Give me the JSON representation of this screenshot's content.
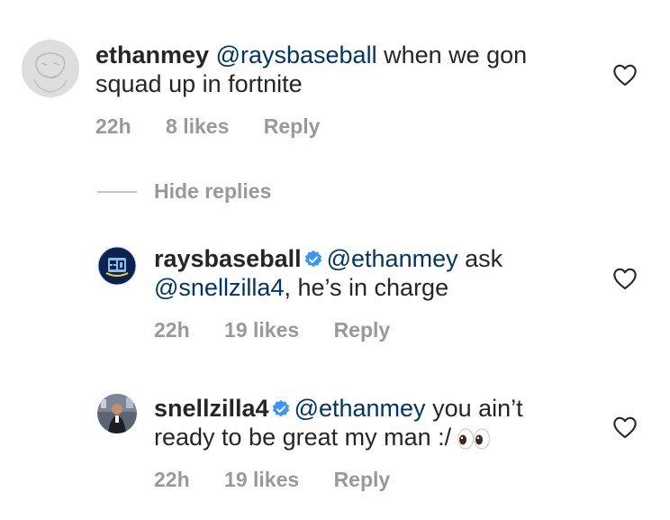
{
  "comment": {
    "username": "ethanmey",
    "mention": "@raysbaseball",
    "text": " when we gon squad up in fortnite",
    "time": "22h",
    "likes": "8 likes",
    "reply_label": "Reply"
  },
  "hide_replies_label": "Hide replies",
  "replies": [
    {
      "username": "raysbaseball",
      "mention": "@ethanmey",
      "text_1": " ask",
      "mention_2": "@snellzilla4",
      "text_2": ", he’s in charge",
      "time": "22h",
      "likes": "19 likes",
      "reply_label": "Reply",
      "verified": true
    },
    {
      "username": "snellzilla4",
      "mention": "@ethanmey",
      "text": " you ain’t ready to be great my man :/",
      "emoji": "eyes-emoji",
      "time": "22h",
      "likes": "19 likes",
      "reply_label": "Reply",
      "verified": true
    }
  ],
  "colors": {
    "text": "#262626",
    "mention": "#003569",
    "meta": "#999999",
    "verified": "#3897f0"
  }
}
